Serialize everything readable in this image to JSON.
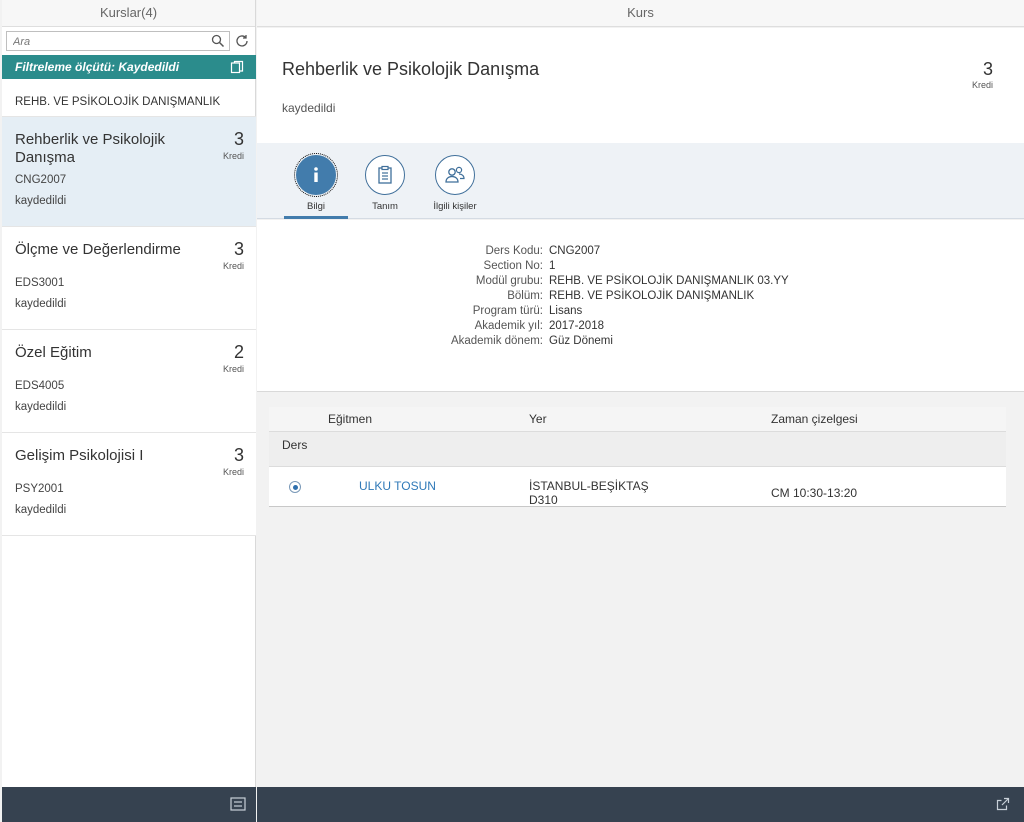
{
  "master": {
    "title": "Kurslar(4)",
    "search": {
      "placeholder": "Ara"
    },
    "filter_text": "Filtreleme ölçütü: Kaydedildi",
    "group_header": "REHB. VE PSİKOLOJİK DANIŞMANLIK",
    "items": [
      {
        "title": "Rehberlik ve Psikolojik Danışma",
        "credits": "3",
        "unit": "Kredi",
        "code": "CNG2007",
        "status": "kaydedildi"
      },
      {
        "title": "Ölçme ve Değerlendirme",
        "credits": "3",
        "unit": "Kredi",
        "code": "EDS3001",
        "status": "kaydedildi"
      },
      {
        "title": "Özel Eğitim",
        "credits": "2",
        "unit": "Kredi",
        "code": "EDS4005",
        "status": "kaydedildi"
      },
      {
        "title": "Gelişim Psikolojisi I",
        "credits": "3",
        "unit": "Kredi",
        "code": "PSY2001",
        "status": "kaydedildi"
      }
    ]
  },
  "detail": {
    "title": "Kurs",
    "header": {
      "title": "Rehberlik ve Psikolojik Danışma",
      "status": "kaydedildi",
      "credits": "3",
      "unit": "Kredi"
    },
    "tabs": [
      {
        "label": "Bilgi",
        "icon": "info-icon"
      },
      {
        "label": "Tanım",
        "icon": "clipboard-icon"
      },
      {
        "label": "İlgili kişiler",
        "icon": "people-icon"
      }
    ],
    "info": [
      {
        "key": "Ders Kodu:",
        "value": "CNG2007"
      },
      {
        "key": "Section No:",
        "value": "1"
      },
      {
        "key": "Modül grubu:",
        "value": "REHB. VE PSİKOLOJİK DANIŞMANLIK 03.YY"
      },
      {
        "key": "Bölüm:",
        "value": "REHB. VE PSİKOLOJİK DANIŞMANLIK"
      },
      {
        "key": "Program türü:",
        "value": "Lisans"
      },
      {
        "key": "Akademik yıl:",
        "value": "2017-2018"
      },
      {
        "key": "Akademik dönem:",
        "value": "Güz Dönemi"
      }
    ],
    "table": {
      "columns": [
        "Eğitmen",
        "Yer",
        "Zaman çizelgesi"
      ],
      "group": "Ders",
      "rows": [
        {
          "instructor": "ULKU TOSUN",
          "place_line1": "İSTANBUL-BEŞİKTAŞ",
          "place_line2": "D310",
          "time": "CM 10:30-13:20"
        }
      ]
    }
  }
}
